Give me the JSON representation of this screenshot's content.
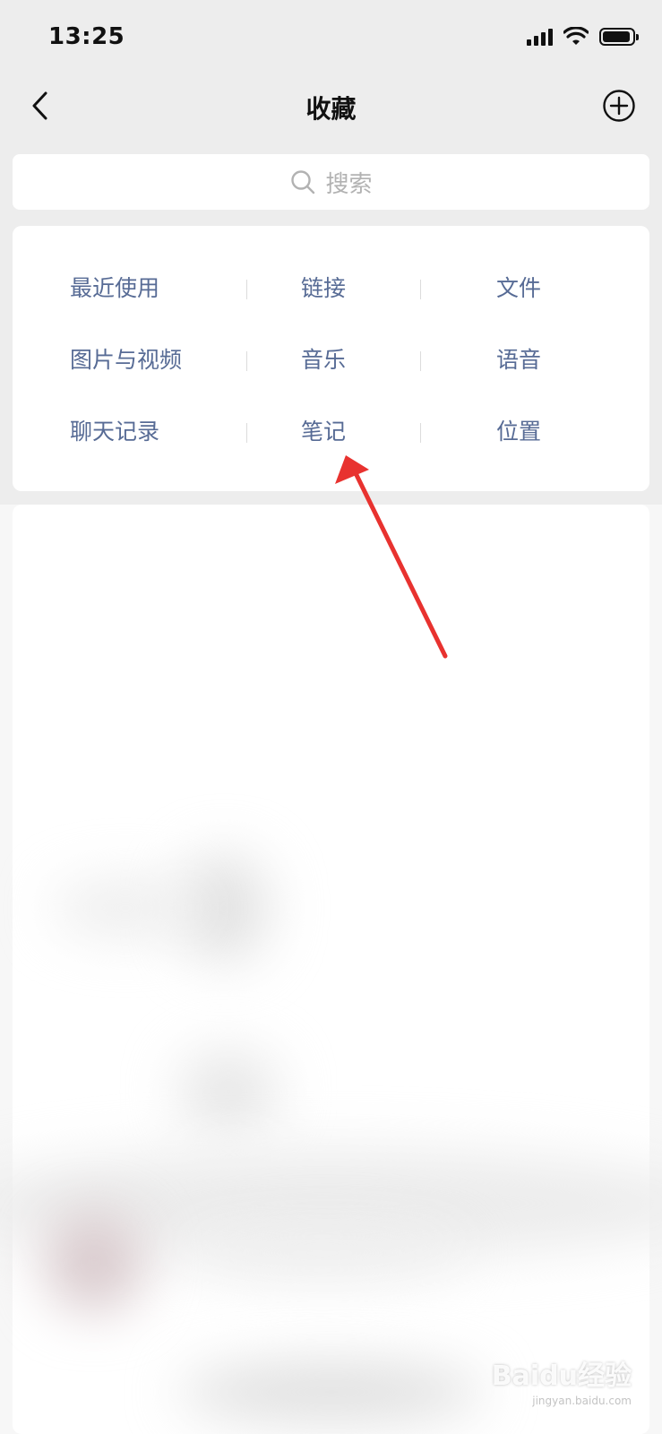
{
  "status_bar": {
    "time": "13:25"
  },
  "nav": {
    "title": "收藏"
  },
  "search": {
    "placeholder": "搜索"
  },
  "categories": [
    [
      "最近使用",
      "链接",
      "文件"
    ],
    [
      "图片与视频",
      "音乐",
      "语音"
    ],
    [
      "聊天记录",
      "笔记",
      "位置"
    ]
  ],
  "colors": {
    "background": "#ededed",
    "link_blue": "#576b95",
    "annotation_red": "#e8322f"
  },
  "watermark": {
    "logo": "Baidu经验",
    "url": "jingyan.baidu.com"
  }
}
